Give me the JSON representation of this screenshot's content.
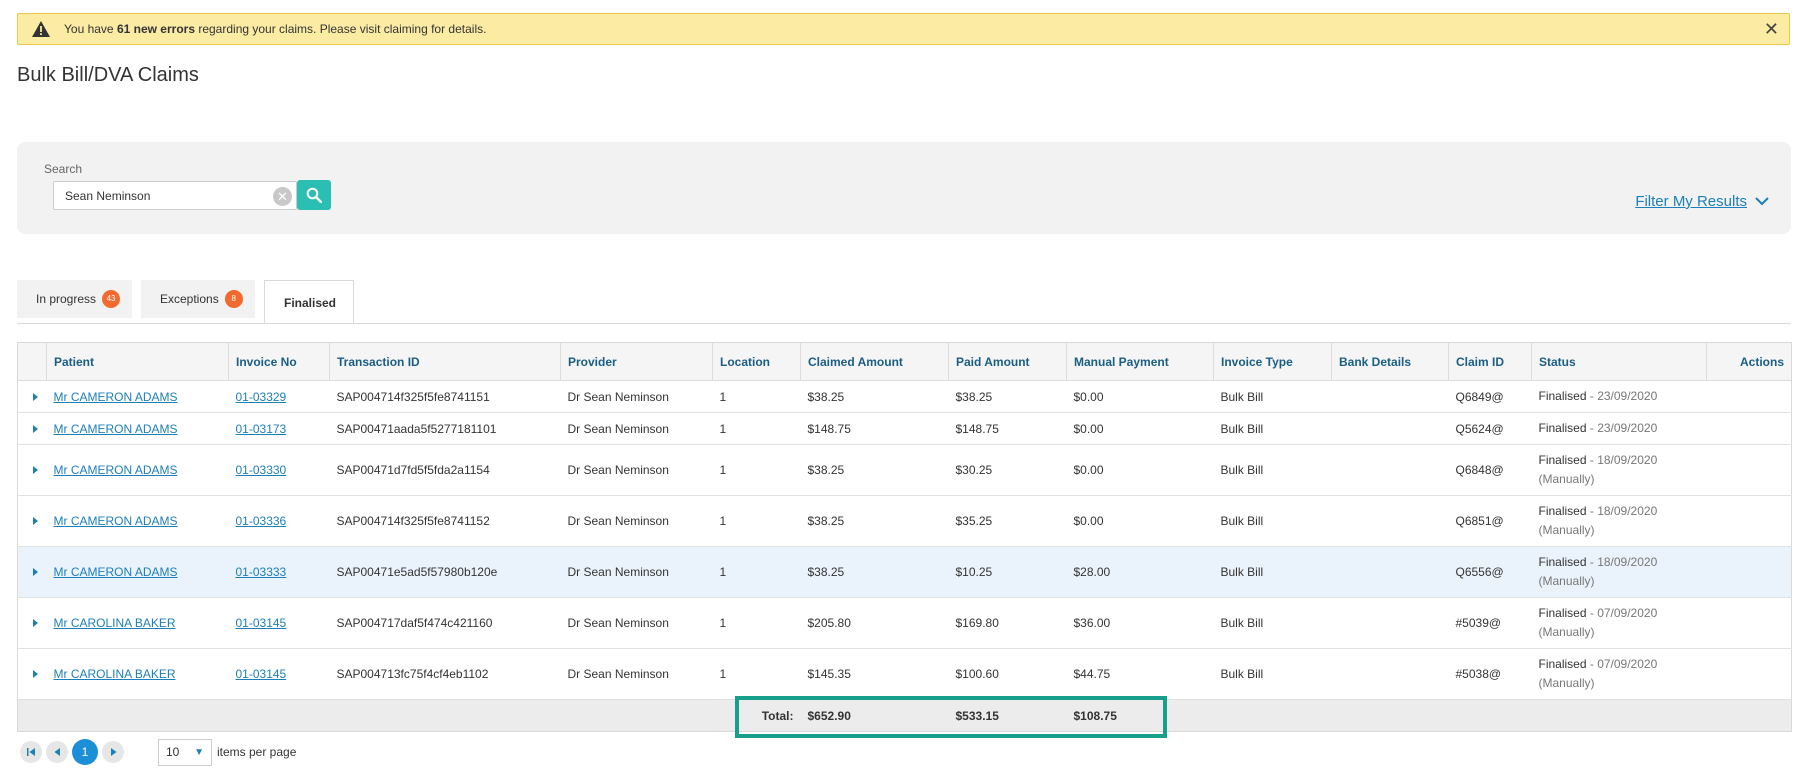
{
  "alert": {
    "prefix": "You have ",
    "bold": "61 new errors",
    "suffix": " regarding your claims. Please visit claiming for details.",
    "close": "✕"
  },
  "page": {
    "title": "Bulk Bill/DVA Claims"
  },
  "search": {
    "label": "Search",
    "value": "Sean Neminson",
    "filter_label": "Filter My Results"
  },
  "tabs": [
    {
      "label": "In progress",
      "badge": "43"
    },
    {
      "label": "Exceptions",
      "badge": "8"
    },
    {
      "label": "Finalised"
    }
  ],
  "table": {
    "columns": [
      "Patient",
      "Invoice No",
      "Transaction ID",
      "Provider",
      "Location",
      "Claimed Amount",
      "Paid Amount",
      "Manual Payment",
      "Invoice Type",
      "Bank Details",
      "Claim ID",
      "Status",
      "Actions"
    ],
    "rows": [
      {
        "patient": "Mr CAMERON ADAMS",
        "invoice": "01-03329",
        "transaction": "SAP004714f325f5fe8741151",
        "provider": "Dr Sean Neminson",
        "location": "1",
        "claimed": "$38.25",
        "paid": "$38.25",
        "manual": "$0.00",
        "type": "Bulk Bill",
        "bank": "",
        "claim_id": "Q6849@",
        "status": "Finalised",
        "status_date": " - 23/09/2020",
        "status_sub": ""
      },
      {
        "patient": "Mr CAMERON ADAMS",
        "invoice": "01-03173",
        "transaction": "SAP00471aada5f5277181101",
        "provider": "Dr Sean Neminson",
        "location": "1",
        "claimed": "$148.75",
        "paid": "$148.75",
        "manual": "$0.00",
        "type": "Bulk Bill",
        "bank": "",
        "claim_id": "Q5624@",
        "status": "Finalised",
        "status_date": " - 23/09/2020",
        "status_sub": ""
      },
      {
        "patient": "Mr CAMERON ADAMS",
        "invoice": "01-03330",
        "transaction": "SAP00471d7fd5f5fda2a1154",
        "provider": "Dr Sean Neminson",
        "location": "1",
        "claimed": "$38.25",
        "paid": "$30.25",
        "manual": "$0.00",
        "type": "Bulk Bill",
        "bank": "",
        "claim_id": "Q6848@",
        "status": "Finalised",
        "status_date": " - 18/09/2020",
        "status_sub": "(Manually)"
      },
      {
        "patient": "Mr CAMERON ADAMS",
        "invoice": "01-03336",
        "transaction": "SAP004714f325f5fe8741152",
        "provider": "Dr Sean Neminson",
        "location": "1",
        "claimed": "$38.25",
        "paid": "$35.25",
        "manual": "$0.00",
        "type": "Bulk Bill",
        "bank": "",
        "claim_id": "Q6851@",
        "status": "Finalised",
        "status_date": " - 18/09/2020",
        "status_sub": "(Manually)"
      },
      {
        "patient": "Mr CAMERON ADAMS",
        "invoice": "01-03333",
        "transaction": "SAP00471e5ad5f57980b120e",
        "provider": "Dr Sean Neminson",
        "location": "1",
        "claimed": "$38.25",
        "paid": "$10.25",
        "manual": "$28.00",
        "type": "Bulk Bill",
        "bank": "",
        "claim_id": "Q6556@",
        "status": "Finalised",
        "status_date": " - 18/09/2020",
        "status_sub": "(Manually)"
      },
      {
        "patient": "Mr CAROLINA BAKER",
        "invoice": "01-03145",
        "transaction": "SAP004717daf5f474c421160",
        "provider": "Dr Sean Neminson",
        "location": "1",
        "claimed": "$205.80",
        "paid": "$169.80",
        "manual": "$36.00",
        "type": "Bulk Bill",
        "bank": "",
        "claim_id": "#5039@",
        "status": "Finalised",
        "status_date": " - 07/09/2020",
        "status_sub": "(Manually)"
      },
      {
        "patient": "Mr CAROLINA BAKER",
        "invoice": "01-03145",
        "transaction": "SAP004713fc75f4cf4eb1102",
        "provider": "Dr Sean Neminson",
        "location": "1",
        "claimed": "$145.35",
        "paid": "$100.60",
        "manual": "$44.75",
        "type": "Bulk Bill",
        "bank": "",
        "claim_id": "#5038@",
        "status": "Finalised",
        "status_date": " - 07/09/2020",
        "status_sub": "(Manually)"
      }
    ],
    "totals": {
      "label": "Total:",
      "claimed": "$652.90",
      "paid": "$533.15",
      "manual": "$108.75"
    }
  },
  "pager": {
    "current": "1",
    "page_size": "10",
    "items_label": "items per page"
  },
  "colors": {
    "accent": "#2bbfb3",
    "link": "#1d7fb8",
    "badge": "#f26a2e",
    "highlight": "#16a08c",
    "alert_bg": "#fbeba3"
  }
}
